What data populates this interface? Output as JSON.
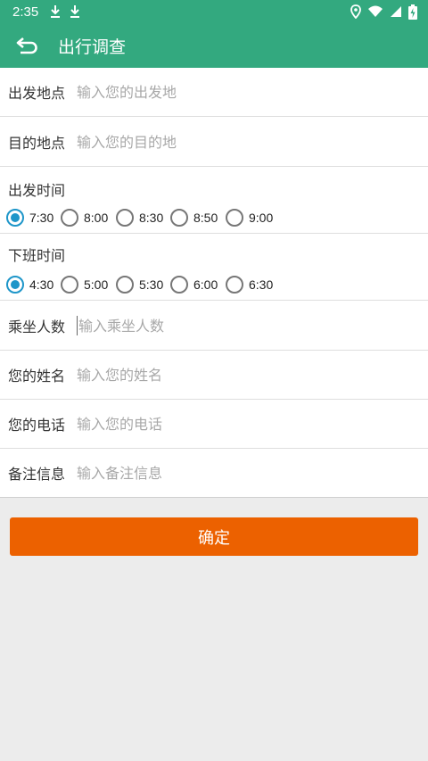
{
  "status_bar": {
    "time": "2:35",
    "icons": [
      "download-icon",
      "download-icon",
      "location-icon",
      "wifi-icon",
      "signal-icon",
      "battery-charging-icon"
    ]
  },
  "app_bar": {
    "title": "出行调查",
    "back_icon": "back-arrow-icon"
  },
  "form": {
    "departure": {
      "label": "出发地点",
      "placeholder": "输入您的出发地",
      "value": ""
    },
    "destination": {
      "label": "目的地点",
      "placeholder": "输入您的目的地",
      "value": ""
    },
    "departure_time": {
      "label": "出发时间",
      "options": [
        "7:30",
        "8:00",
        "8:30",
        "8:50",
        "9:00"
      ],
      "selected": "7:30"
    },
    "off_work_time": {
      "label": "下班时间",
      "options": [
        "4:30",
        "5:00",
        "5:30",
        "6:00",
        "6:30"
      ],
      "selected": "4:30"
    },
    "passengers": {
      "label": "乘坐人数",
      "placeholder": "输入乘坐人数",
      "value": ""
    },
    "name": {
      "label": "您的姓名",
      "placeholder": "输入您的姓名",
      "value": ""
    },
    "phone": {
      "label": "您的电话",
      "placeholder": "输入您的电话",
      "value": ""
    },
    "remarks": {
      "label": "备注信息",
      "placeholder": "输入备注信息",
      "value": ""
    }
  },
  "confirm_button": {
    "label": "确定"
  },
  "colors": {
    "primary": "#33a97f",
    "accent_button": "#ec6100",
    "radio_checked": "#1e96c9",
    "background": "#ececec"
  }
}
